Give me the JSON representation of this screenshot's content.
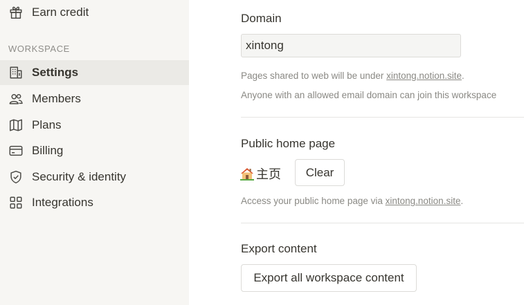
{
  "sidebar": {
    "earn_credit": "Earn credit",
    "section_label": "WORKSPACE",
    "items": [
      {
        "label": "Settings",
        "icon": "building-icon",
        "active": true
      },
      {
        "label": "Members",
        "icon": "people-icon"
      },
      {
        "label": "Plans",
        "icon": "map-icon"
      },
      {
        "label": "Billing",
        "icon": "credit-card-icon"
      },
      {
        "label": "Security & identity",
        "icon": "shield-icon"
      },
      {
        "label": "Integrations",
        "icon": "grid-icon"
      }
    ]
  },
  "domain": {
    "heading": "Domain",
    "value": "xintong",
    "help_prefix": "Pages shared to web will be under ",
    "help_link": "xintong.notion.site",
    "help_suffix": ".",
    "join_text": "Anyone with an allowed email domain can join this workspace"
  },
  "public_home": {
    "heading": "Public home page",
    "page_title": "主页",
    "page_icon": "house-emoji-icon",
    "clear_label": "Clear",
    "help_prefix": "Access your public home page via ",
    "help_link": "xintong.notion.site",
    "help_suffix": "."
  },
  "export": {
    "heading": "Export content",
    "button_label": "Export all workspace content"
  }
}
